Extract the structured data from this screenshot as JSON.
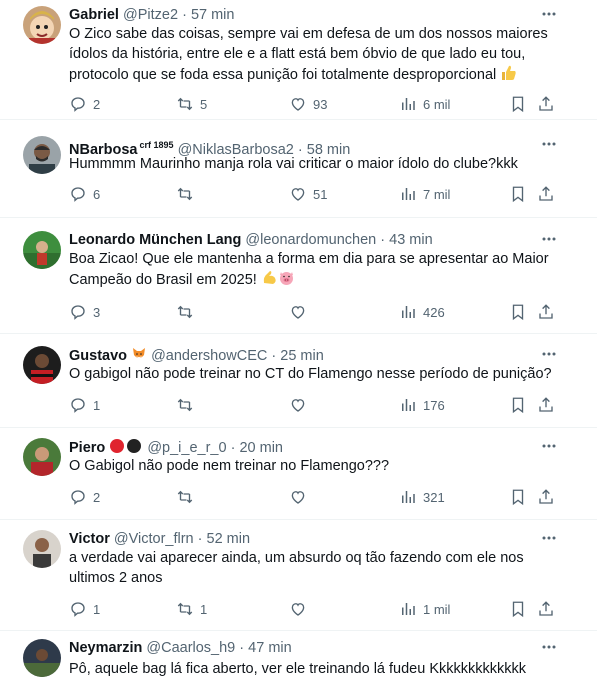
{
  "tweets": [
    {
      "author": "Gabriel",
      "badge": "",
      "emoji_after_name": "",
      "handle": "@Pitze2",
      "time": "57 min",
      "lines": [
        "O Zico sabe das coisas, sempre vai em defesa de um dos nossos maiores",
        "ídolos da história, entre ele e a flatt está bem óbvio de que lado eu tou,",
        "protocolo que se foda essa punição foi totalmente desproporcional"
      ],
      "text_emojis": [
        "thumbs-up"
      ],
      "replies": "2",
      "retweets": "5",
      "likes": "93",
      "views": "6 mil"
    },
    {
      "author": "NBarbosa",
      "badge": "crf 1895",
      "emoji_after_name": "",
      "handle": "@NiklasBarbosa2",
      "time": "58 min",
      "lines": [
        "Hummmm Maurinho manja rola vai criticar o maior ídolo do clube?kkk"
      ],
      "text_emojis": [],
      "replies": "6",
      "retweets": "",
      "likes": "51",
      "views": "7 mil"
    },
    {
      "author": "Leonardo München Lang",
      "badge": "",
      "emoji_after_name": "",
      "handle": "@leonardomunchen",
      "time": "43 min",
      "lines": [
        "Boa Zicao! Que ele mantenha a forma em dia para se apresentar ao Maior",
        "Campeão do Brasil em 2025!"
      ],
      "text_emojis": [
        "flexed-biceps",
        "pig-face"
      ],
      "replies": "3",
      "retweets": "",
      "likes": "",
      "views": "426"
    },
    {
      "author": "Gustavo",
      "badge": "",
      "emoji_after_name": "fox-face",
      "handle": "@andershowCEC",
      "time": "25 min",
      "lines": [
        "O gabigol não pode treinar no CT do Flamengo nesse período de punição?"
      ],
      "text_emojis": [],
      "replies": "1",
      "retweets": "",
      "likes": "",
      "views": "176"
    },
    {
      "author": "Piero",
      "badge": "",
      "emoji_after_name": "red-black-circles",
      "handle": "@p_i_e_r_0",
      "time": "20 min",
      "lines": [
        "O Gabigol não pode nem treinar no Flamengo???"
      ],
      "text_emojis": [],
      "replies": "2",
      "retweets": "",
      "likes": "",
      "views": "321"
    },
    {
      "author": "Victor",
      "badge": "",
      "emoji_after_name": "",
      "handle": "@Victor_flrn",
      "time": "52 min",
      "lines": [
        "a verdade vai aparecer ainda, um absurdo oq tão fazendo com ele nos",
        "ultimos 2 anos"
      ],
      "text_emojis": [],
      "replies": "1",
      "retweets": "1",
      "likes": "",
      "views": "1 mil"
    },
    {
      "author": "Neymarzin",
      "badge": "",
      "emoji_after_name": "",
      "handle": "@Caarlos_h9",
      "time": "47 min",
      "lines": [
        "Pô, aquele bag lá fica aberto, ver ele treinando lá fudeu Kkkkkkkkkkkkk"
      ],
      "text_emojis": [],
      "replies": "",
      "retweets": "",
      "likes": "",
      "views": ""
    }
  ],
  "colors": {
    "text": "#0f1419",
    "secondary": "#536471",
    "divider": "#eff3f4"
  },
  "icons": {
    "reply": "reply-icon",
    "retweet": "retweet-icon",
    "like": "heart-icon",
    "views": "views-chart-icon",
    "bookmark": "bookmark-icon",
    "share": "share-icon",
    "more": "more-icon"
  }
}
